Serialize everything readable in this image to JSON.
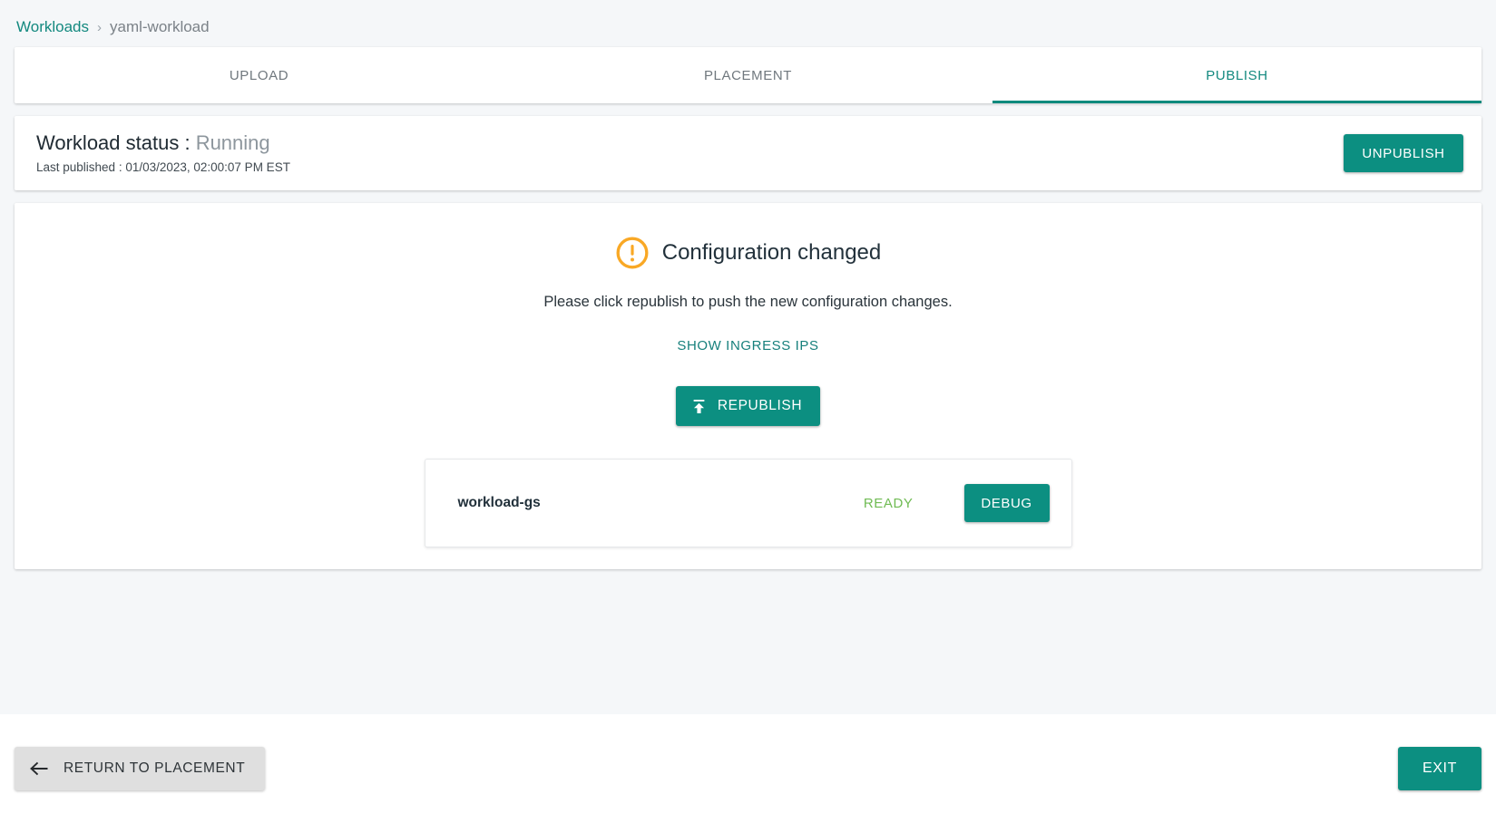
{
  "breadcrumb": {
    "root": "Workloads",
    "separator": "›",
    "current": "yaml-workload"
  },
  "tabs": [
    {
      "label": "UPLOAD",
      "active": false
    },
    {
      "label": "PLACEMENT",
      "active": false
    },
    {
      "label": "PUBLISH",
      "active": true
    }
  ],
  "status": {
    "label": "Workload status :",
    "value": "Running",
    "last_published": "Last published : 01/03/2023, 02:00:07 PM EST",
    "unpublish_label": "UNPUBLISH"
  },
  "content": {
    "warning_icon": "alert-circle-icon",
    "heading": "Configuration changed",
    "description": "Please click republish to push the new configuration changes.",
    "ingress_link": "SHOW INGRESS IPS",
    "republish_label": "REPUBLISH",
    "republish_icon": "upload-icon"
  },
  "workload": {
    "name": "workload-gs",
    "state": "READY",
    "debug_label": "DEBUG"
  },
  "footer": {
    "return_label": "RETURN TO PLACEMENT",
    "return_icon": "arrow-left-icon",
    "exit_label": "EXIT"
  },
  "colors": {
    "accent_teal": "#0c8f81",
    "link_teal": "#13897f",
    "warning_orange": "#f9a825",
    "ready_green": "#6fbb53",
    "page_background": "#f5f7f9"
  }
}
